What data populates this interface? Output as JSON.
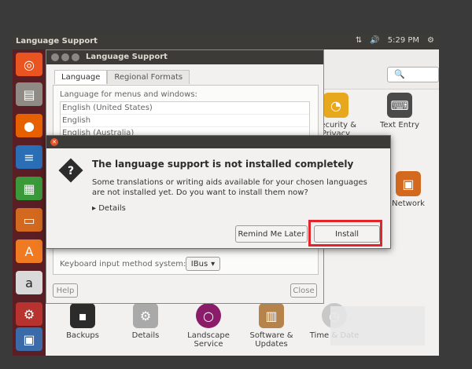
{
  "topbar": {
    "app_title": "Language Support",
    "time": "5:29 PM"
  },
  "launcher": {
    "items": [
      "ubuntu-icon",
      "files-icon",
      "firefox-icon",
      "writer-icon",
      "calc-icon",
      "impress-icon",
      "software-center-icon",
      "amazon-icon",
      "system-settings-icon"
    ]
  },
  "settings": {
    "tiles_top": [
      {
        "label": "Security & Privacy"
      },
      {
        "label": "Text Entry"
      }
    ],
    "tile_network": "Network",
    "tiles_bottom": [
      {
        "label": "Backups"
      },
      {
        "label": "Details"
      },
      {
        "label": "Landscape Service"
      },
      {
        "label": "Software & Updates"
      },
      {
        "label": "Time & Date"
      }
    ]
  },
  "language_window": {
    "title": "Language Support",
    "tabs": [
      "Language",
      "Regional Formats"
    ],
    "menus_label": "Language for menus and windows:",
    "languages": [
      "English (United States)",
      "English",
      "English (Australia)"
    ],
    "input_method_label": "Keyboard input method system:",
    "input_method_value": "IBus",
    "help_label": "Help",
    "close_label": "Close"
  },
  "dialog": {
    "heading": "The language support is not installed completely",
    "body": "Some translations or writing aids available for your chosen languages are not installed yet. Do you want to install them now?",
    "details_label": "Details",
    "remind_label": "Remind Me Later",
    "install_label": "Install"
  },
  "colors": {
    "highlight": "#e2252b",
    "launcher": "#5a1f24",
    "panel": "#3c3b37"
  }
}
